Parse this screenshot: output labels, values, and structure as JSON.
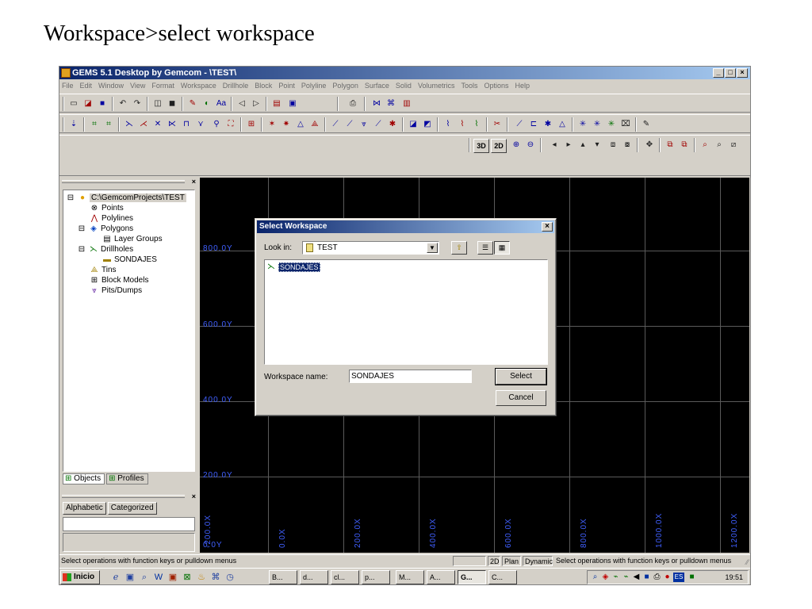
{
  "slide": {
    "title": "Workspace>select workspace"
  },
  "window": {
    "title": "GEMS 5.1 Desktop by Gemcom - \\TEST\\",
    "minimize": "_",
    "maximize": "□",
    "close": "×"
  },
  "menu": [
    "File",
    "Edit",
    "Window",
    "View",
    "Format",
    "Workspace",
    "Drillhole",
    "Block",
    "Point",
    "Polyline",
    "Polygon",
    "Surface",
    "Solid",
    "Volumetrics",
    "Tools",
    "Options",
    "Help"
  ],
  "toolbar": {
    "btn_3d": "3D",
    "btn_2d": "2D"
  },
  "tree": {
    "root": "C:\\GemcomProjects\\TEST",
    "items": [
      "Points",
      "Polylines",
      "Polygons",
      "Layer Groups",
      "Drillholes",
      "SONDAJES",
      "Tins",
      "Block Models",
      "Pits/Dumps"
    ]
  },
  "panel_tabs": {
    "objects": "Objects",
    "profiles": "Profiles"
  },
  "props_tabs": {
    "alphabetic": "Alphabetic",
    "categorized": "Categorized"
  },
  "canvas": {
    "y_labels": [
      "800.0Y",
      "600.0Y",
      "400.0Y",
      "200.0Y",
      "0.0Y"
    ],
    "x_labels": [
      "-200.0X",
      "0.0X",
      "200.0X",
      "400.0X",
      "600.0X",
      "800.0X",
      "1000.0X",
      "1200.0X"
    ]
  },
  "status": {
    "left": "Select operations with function keys or pulldown menus",
    "mode_2d": "2D",
    "plan": "Plan",
    "dynamic": "Dynamic",
    "right": "Select operations with function keys or pulldown menus"
  },
  "taskbar": {
    "start": "Inicio",
    "tasks": [
      "B...",
      "d...",
      "cl...",
      "p...",
      "M...",
      "A...",
      "G...",
      "C..."
    ],
    "clock": "19:51",
    "lang": "ES"
  },
  "dialog": {
    "title": "Select Workspace",
    "close": "×",
    "look_in_label": "Look in:",
    "look_in_value": "TEST",
    "files": [
      "SONDAJES"
    ],
    "workspace_name_label": "Workspace name:",
    "workspace_name_value": "SONDAJES",
    "select_button": "Select",
    "cancel_button": "Cancel"
  }
}
